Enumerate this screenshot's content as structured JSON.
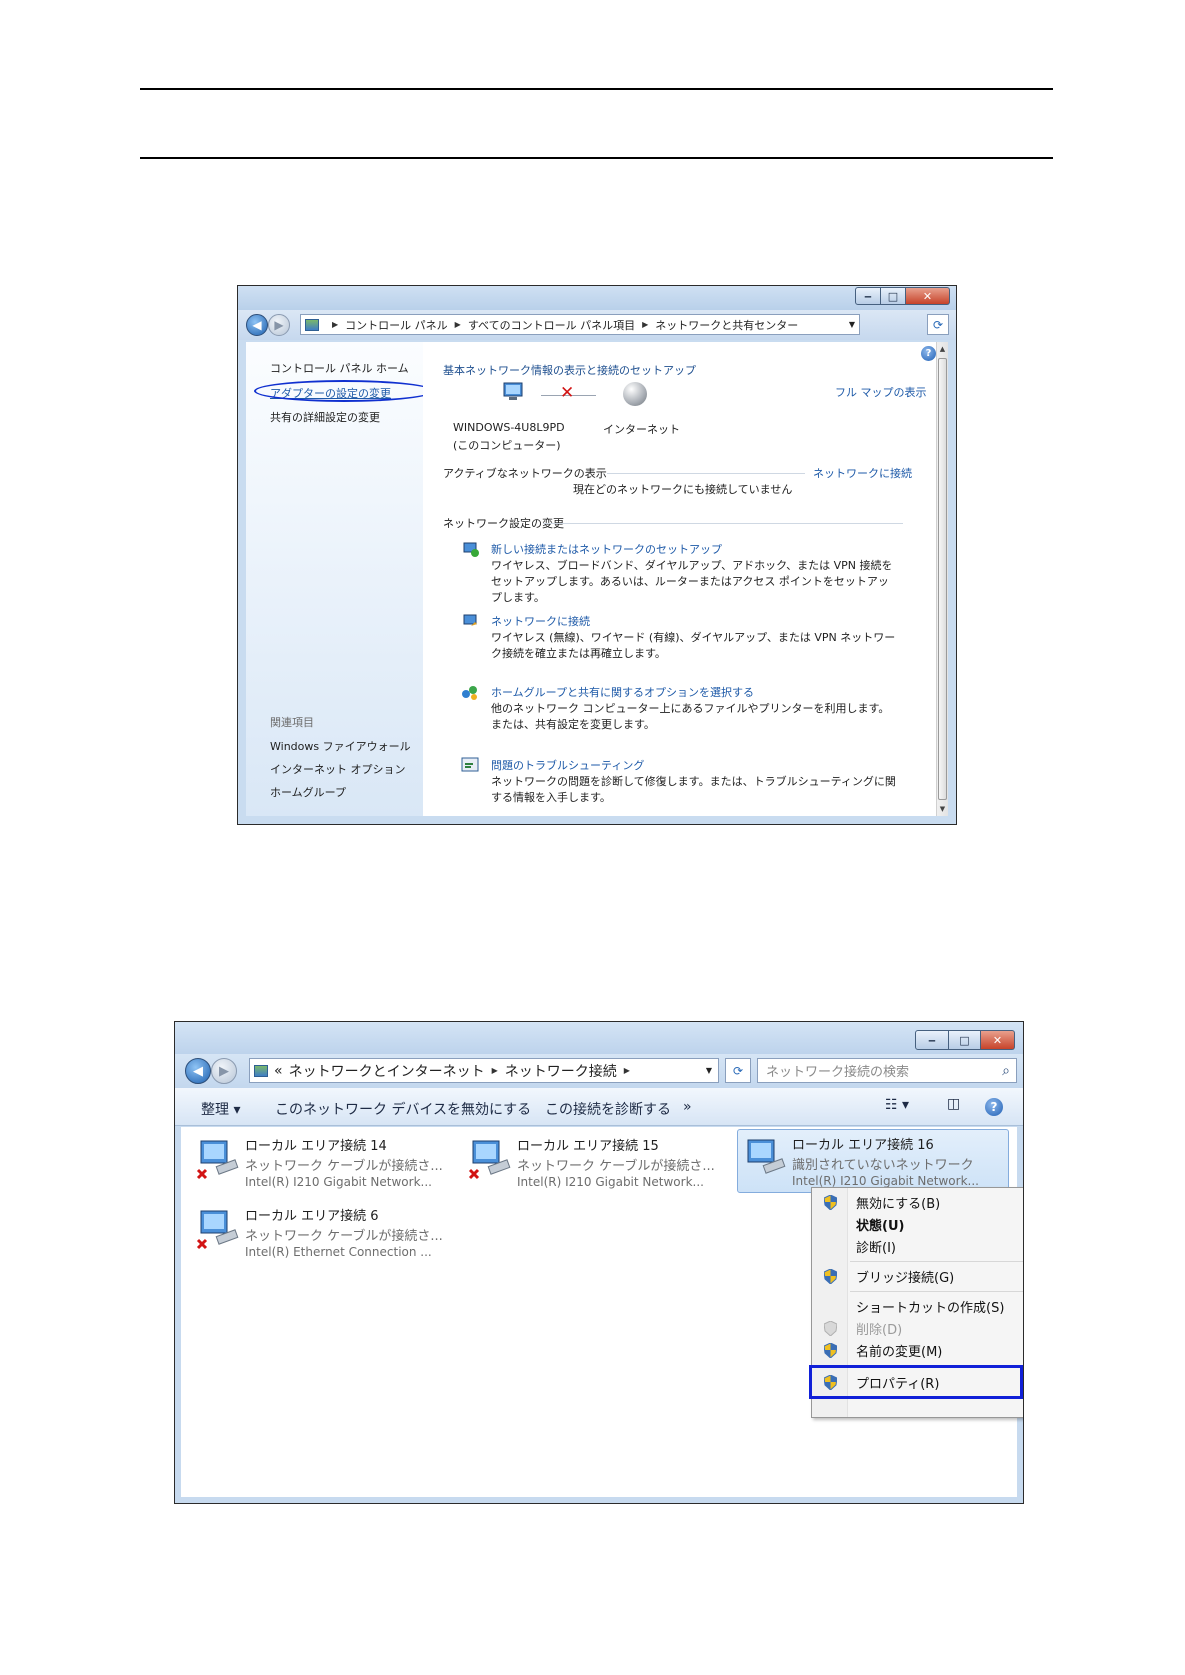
{
  "window1": {
    "address": [
      "コントロール パネル",
      "すべてのコントロール パネル項目",
      "ネットワークと共有センター"
    ],
    "sidebar": {
      "home": "コントロール パネル ホーム",
      "adapter_settings": "アダプターの設定の変更",
      "advanced_sharing": "共有の詳細設定の変更",
      "related_heading": "関連項目",
      "related": [
        "Windows ファイアウォール",
        "インターネット オプション",
        "ホームグループ"
      ]
    },
    "content": {
      "heading": "基本ネットワーク情報の表示と接続のセットアップ",
      "full_map": "フル マップの表示",
      "computer_name": "WINDOWS-4U8L9PD",
      "computer_sub": "(このコンピューター)",
      "internet": "インターネット",
      "active_heading": "アクティブなネットワークの表示",
      "connect_link": "ネットワークに接続",
      "not_connected": "現在どのネットワークにも接続していません",
      "change_heading": "ネットワーク設定の変更",
      "tasks": [
        {
          "title": "新しい接続またはネットワークのセットアップ",
          "desc": "ワイヤレス、ブロードバンド、ダイヤルアップ、アドホック、または VPN 接続をセットアップします。あるいは、ルーターまたはアクセス ポイントをセットアップします。"
        },
        {
          "title": "ネットワークに接続",
          "desc": "ワイヤレス (無線)、ワイヤード (有線)、ダイヤルアップ、または VPN ネットワーク接続を確立または再確立します。"
        },
        {
          "title": "ホームグループと共有に関するオプションを選択する",
          "desc": "他のネットワーク コンピューター上にあるファイルやプリンターを利用します。または、共有設定を変更します。"
        },
        {
          "title": "問題のトラブルシューティング",
          "desc": "ネットワークの問題を診断して修復します。または、トラブルシューティングに関する情報を入手します。"
        }
      ]
    }
  },
  "window2": {
    "address_prefix": "«",
    "address": [
      "ネットワークとインターネット",
      "ネットワーク接続"
    ],
    "search_placeholder": "ネットワーク接続の検索",
    "toolbar": {
      "organize": "整理 ▾",
      "disable_device": "このネットワーク デバイスを無効にする",
      "diagnose": "この接続を診断する",
      "more": "»"
    },
    "adapters": [
      {
        "name": "ローカル エリア接続 14",
        "status": "ネットワーク ケーブルが接続さ...",
        "device": "Intel(R) I210 Gigabit Network..."
      },
      {
        "name": "ローカル エリア接続 15",
        "status": "ネットワーク ケーブルが接続さ...",
        "device": "Intel(R) I210 Gigabit Network..."
      },
      {
        "name": "ローカル エリア接続 16",
        "status": "識別されていないネットワーク",
        "device": "Intel(R) I210 Gigabit Network..."
      },
      {
        "name": "ローカル エリア接続 6",
        "status": "ネットワーク ケーブルが接続さ...",
        "device": "Intel(R) Ethernet Connection ..."
      }
    ],
    "context_menu": {
      "disable": "無効にする(B)",
      "status": "状態(U)",
      "diagnose": "診断(I)",
      "bridge": "ブリッジ接続(G)",
      "shortcut": "ショートカットの作成(S)",
      "delete": "削除(D)",
      "rename": "名前の変更(M)",
      "properties": "プロパティ(R)"
    }
  },
  "colors": {
    "link": "#1e5aa8",
    "highlight": "#1020d8",
    "error": "#d21414"
  }
}
